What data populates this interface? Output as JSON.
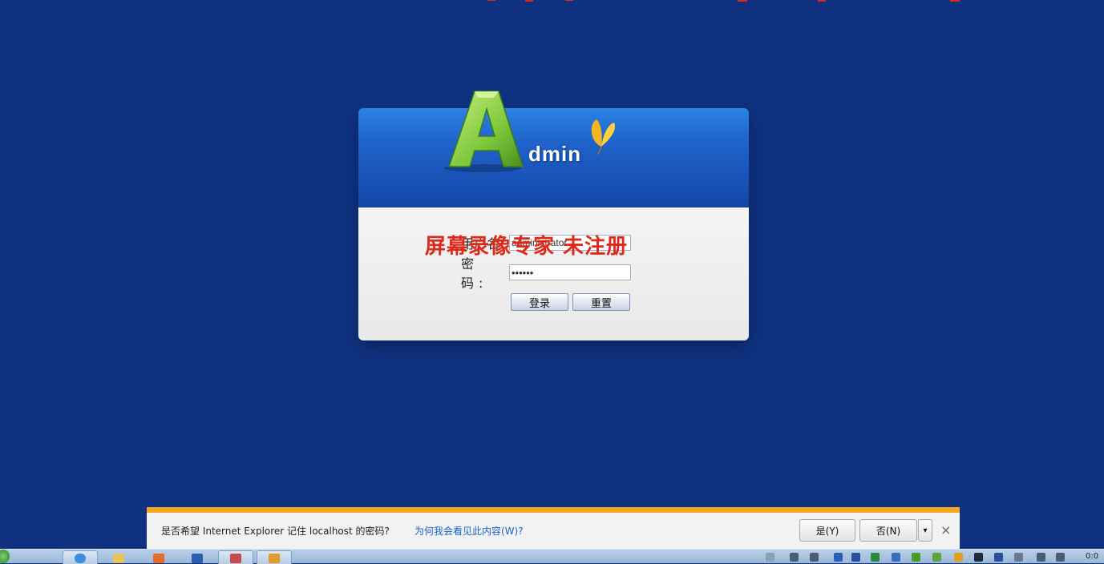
{
  "login": {
    "logo_letter": "A",
    "logo_text": "dmin",
    "username_label": "用户名:",
    "username_value": "administrator",
    "password_label": "密 码:",
    "password_value": "••••••",
    "login_button": "登录",
    "reset_button": "重置"
  },
  "watermark": "屏幕录像专家 未注册",
  "notification": {
    "message": "是否希望 Internet Explorer 记住 localhost 的密码?",
    "link": "为何我会看见此内容(W)?",
    "yes_button": "是(Y)",
    "no_button": "否(N)",
    "dropdown": "▾",
    "close": "×"
  },
  "taskbar": {
    "time": "0:0"
  },
  "colors": {
    "background": "#0f3180",
    "notify_accent": "#f5a623",
    "watermark": "#e02818"
  }
}
